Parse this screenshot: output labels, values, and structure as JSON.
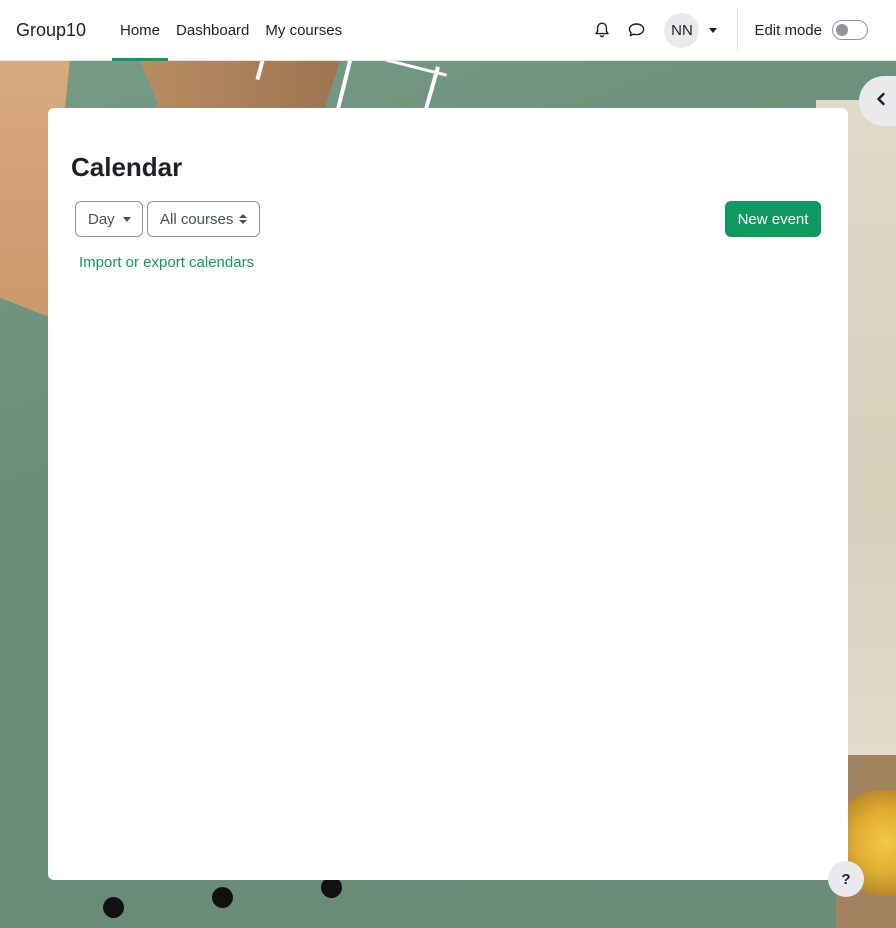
{
  "brand": "Group10",
  "nav": {
    "items": [
      {
        "label": "Home",
        "active": true
      },
      {
        "label": "Dashboard",
        "active": false
      },
      {
        "label": "My courses",
        "active": false
      }
    ]
  },
  "user": {
    "initials": "NN"
  },
  "edit_mode": {
    "label": "Edit mode",
    "enabled": false
  },
  "page": {
    "title": "Calendar",
    "view_select": "Day",
    "course_select": "All courses",
    "new_event_label": "New event",
    "import_link": "Import or export calendars"
  },
  "help": {
    "label": "?"
  },
  "colors": {
    "accent": "#0f9960",
    "text": "#1d2125",
    "background_green": "#6b8f7b"
  },
  "icons": [
    "bell-icon",
    "chat-icon",
    "chevron-down-icon",
    "chevron-left-icon",
    "question-icon"
  ]
}
